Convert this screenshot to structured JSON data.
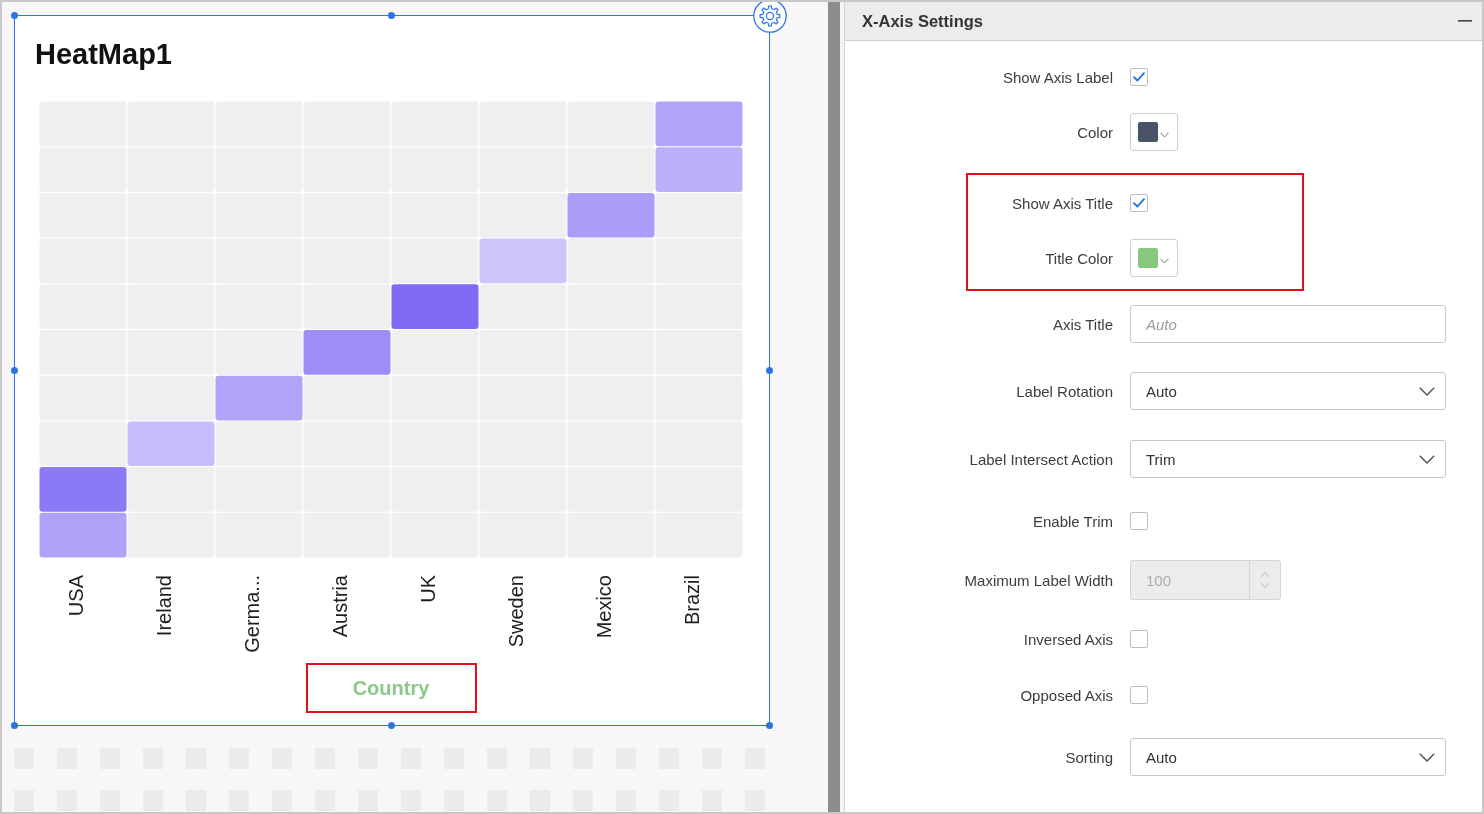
{
  "canvas": {
    "widget": {
      "title": "HeatMap1",
      "selected": true,
      "heatmap": {
        "rows": [
          {
            "cells": [
              {
                "color": "#efefef"
              },
              {
                "color": "#efefef"
              },
              {
                "color": "#efefef"
              },
              {
                "color": "#efefef"
              },
              {
                "color": "#efefef"
              },
              {
                "color": "#efefef"
              },
              {
                "color": "#efefef"
              },
              {
                "color": "#b1a4f8"
              }
            ]
          },
          {
            "cells": [
              {
                "color": "#efefef"
              },
              {
                "color": "#efefef"
              },
              {
                "color": "#efefef"
              },
              {
                "color": "#efefef"
              },
              {
                "color": "#efefef"
              },
              {
                "color": "#efefef"
              },
              {
                "color": "#efefef"
              },
              {
                "color": "#bcb1f9"
              }
            ]
          },
          {
            "cells": [
              {
                "color": "#efefef"
              },
              {
                "color": "#efefef"
              },
              {
                "color": "#efefef"
              },
              {
                "color": "#efefef"
              },
              {
                "color": "#efefef"
              },
              {
                "color": "#efefef"
              },
              {
                "color": "#aa9cf7"
              },
              {
                "color": "#efefef"
              }
            ]
          },
          {
            "cells": [
              {
                "color": "#efefef"
              },
              {
                "color": "#efefef"
              },
              {
                "color": "#efefef"
              },
              {
                "color": "#efefef"
              },
              {
                "color": "#efefef"
              },
              {
                "color": "#cdc5fc"
              },
              {
                "color": "#efefef"
              },
              {
                "color": "#efefef"
              }
            ]
          },
          {
            "cells": [
              {
                "color": "#efefef"
              },
              {
                "color": "#efefef"
              },
              {
                "color": "#efefef"
              },
              {
                "color": "#efefef"
              },
              {
                "color": "#8069f5"
              },
              {
                "color": "#efefef"
              },
              {
                "color": "#efefef"
              },
              {
                "color": "#efefef"
              }
            ]
          },
          {
            "cells": [
              {
                "color": "#efefef"
              },
              {
                "color": "#efefef"
              },
              {
                "color": "#efefef"
              },
              {
                "color": "#9d8ef7"
              },
              {
                "color": "#efefef"
              },
              {
                "color": "#efefef"
              },
              {
                "color": "#efefef"
              },
              {
                "color": "#efefef"
              }
            ]
          },
          {
            "cells": [
              {
                "color": "#efefef"
              },
              {
                "color": "#efefef"
              },
              {
                "color": "#b0a4f8"
              },
              {
                "color": "#efefef"
              },
              {
                "color": "#efefef"
              },
              {
                "color": "#efefef"
              },
              {
                "color": "#efefef"
              },
              {
                "color": "#efefef"
              }
            ]
          },
          {
            "cells": [
              {
                "color": "#efefef"
              },
              {
                "color": "#c6bdfa"
              },
              {
                "color": "#efefef"
              },
              {
                "color": "#efefef"
              },
              {
                "color": "#efefef"
              },
              {
                "color": "#efefef"
              },
              {
                "color": "#efefef"
              },
              {
                "color": "#efefef"
              }
            ]
          },
          {
            "cells": [
              {
                "color": "#8a7af6"
              },
              {
                "color": "#efefef"
              },
              {
                "color": "#efefef"
              },
              {
                "color": "#efefef"
              },
              {
                "color": "#efefef"
              },
              {
                "color": "#efefef"
              },
              {
                "color": "#efefef"
              },
              {
                "color": "#efefef"
              }
            ]
          },
          {
            "cells": [
              {
                "color": "#afa3f8"
              },
              {
                "color": "#efefef"
              },
              {
                "color": "#efefef"
              },
              {
                "color": "#efefef"
              },
              {
                "color": "#efefef"
              },
              {
                "color": "#efefef"
              },
              {
                "color": "#efefef"
              },
              {
                "color": "#efefef"
              }
            ]
          }
        ],
        "x_labels": [
          "USA",
          "Ireland",
          "Germa...",
          "Austria",
          "UK",
          "Sweden",
          "Mexico",
          "Brazil"
        ],
        "axis_title": {
          "text": "Country",
          "highlighted": true
        }
      }
    }
  },
  "settings_panel": {
    "title": "X-Axis Settings",
    "sections": [
      {
        "highlighted": false,
        "rows": [
          {
            "kind": "checkbox",
            "label": "Show Axis Label",
            "checked": true
          },
          {
            "kind": "color",
            "label": "Color",
            "color": "#4a5366"
          }
        ]
      },
      {
        "highlighted": true,
        "rows": [
          {
            "kind": "checkbox",
            "label": "Show Axis Title",
            "checked": true
          },
          {
            "kind": "color",
            "label": "Title Color",
            "color": "#86c87f"
          }
        ]
      },
      {
        "highlighted": false,
        "rows": [
          {
            "kind": "text",
            "label": "Axis Title",
            "placeholder": "Auto"
          },
          {
            "kind": "dropdown",
            "label": "Label Rotation",
            "value": "Auto"
          },
          {
            "kind": "dropdown",
            "label": "Label Intersect Action",
            "value": "Trim"
          },
          {
            "kind": "checkbox",
            "label": "Enable Trim",
            "checked": false
          },
          {
            "kind": "number",
            "label": "Maximum Label Width",
            "value": "100",
            "disabled": true
          },
          {
            "kind": "checkbox",
            "label": "Inversed Axis",
            "checked": false
          },
          {
            "kind": "checkbox",
            "label": "Opposed Axis",
            "checked": false
          },
          {
            "kind": "dropdown",
            "label": "Sorting",
            "value": "Auto"
          }
        ]
      }
    ]
  }
}
